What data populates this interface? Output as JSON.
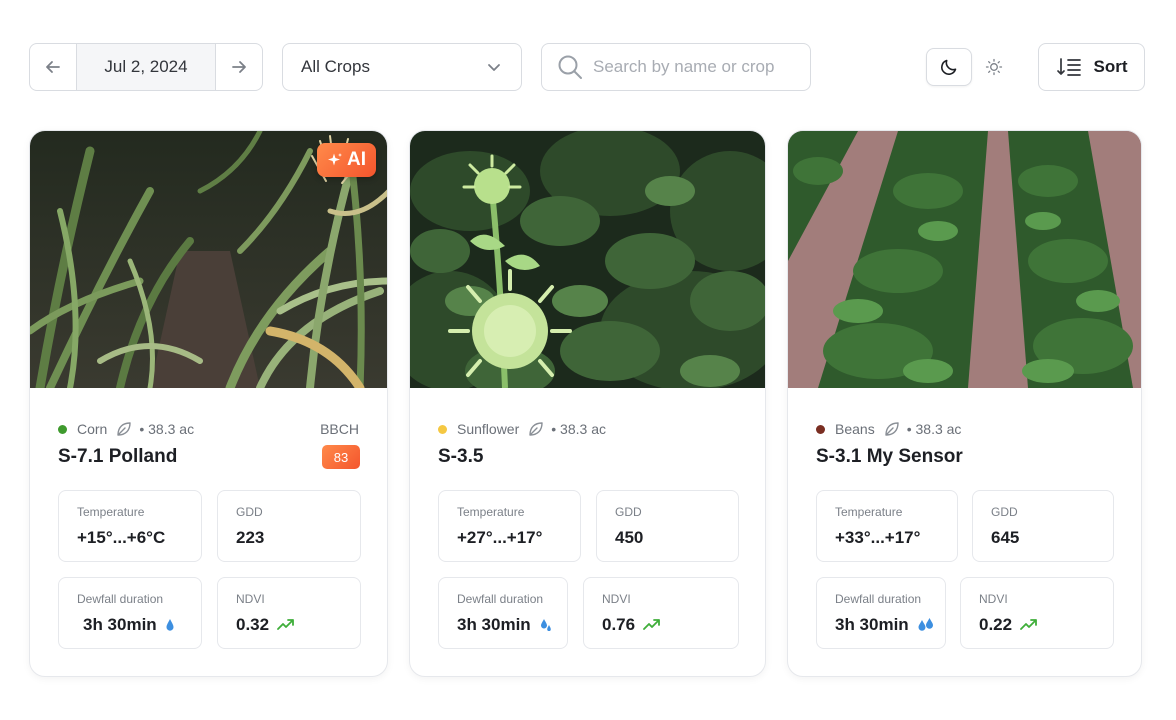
{
  "toolbar": {
    "date": "Jul 2, 2024",
    "crop_filter": "All Crops",
    "search_placeholder": "Search by name or crop",
    "sort_label": "Sort"
  },
  "cards": [
    {
      "crop": "Corn",
      "crop_color": "#3f9a2e",
      "area": "• 38.3 ac",
      "title": "S-7.1 Polland",
      "ai_badge": "AI",
      "bbch_label": "BBCH",
      "bbch_value": "83",
      "temperature_label": "Temperature",
      "temperature": "+15°...+6°C",
      "gdd_label": "GDD",
      "gdd": "223",
      "dewfall_label": "Dewfall duration",
      "dewfall": "3h 30min",
      "ndvi_label": "NDVI",
      "ndvi": "0.32"
    },
    {
      "crop": "Sunflower",
      "crop_color": "#f5c842",
      "area": "• 38.3 ac",
      "title": "S-3.5",
      "temperature_label": "Temperature",
      "temperature": "+27°...+17°",
      "gdd_label": "GDD",
      "gdd": "450",
      "dewfall_label": "Dewfall duration",
      "dewfall": "3h 30min",
      "ndvi_label": "NDVI",
      "ndvi": "0.76"
    },
    {
      "crop": "Beans",
      "crop_color": "#7a2e22",
      "area": "• 38.3 ac",
      "title": "S-3.1 My Sensor",
      "temperature_label": "Temperature",
      "temperature": "+33°...+17°",
      "gdd_label": "GDD",
      "gdd": "645",
      "dewfall_label": "Dewfall duration",
      "dewfall": "3h 30min",
      "ndvi_label": "NDVI",
      "ndvi": "0.22"
    }
  ],
  "colors": {
    "accent_orange": "#f4552d",
    "ndvi_trend_green": "#3fae3a",
    "dew_blue": "#3d8fe0"
  },
  "icons": [
    "arrow-left-icon",
    "arrow-right-icon",
    "chevron-down-icon",
    "search-icon",
    "moon-icon",
    "sun-icon",
    "sort-icon",
    "sparkle-icon",
    "leaf-icon",
    "water-drop-icon",
    "trend-up-icon"
  ]
}
